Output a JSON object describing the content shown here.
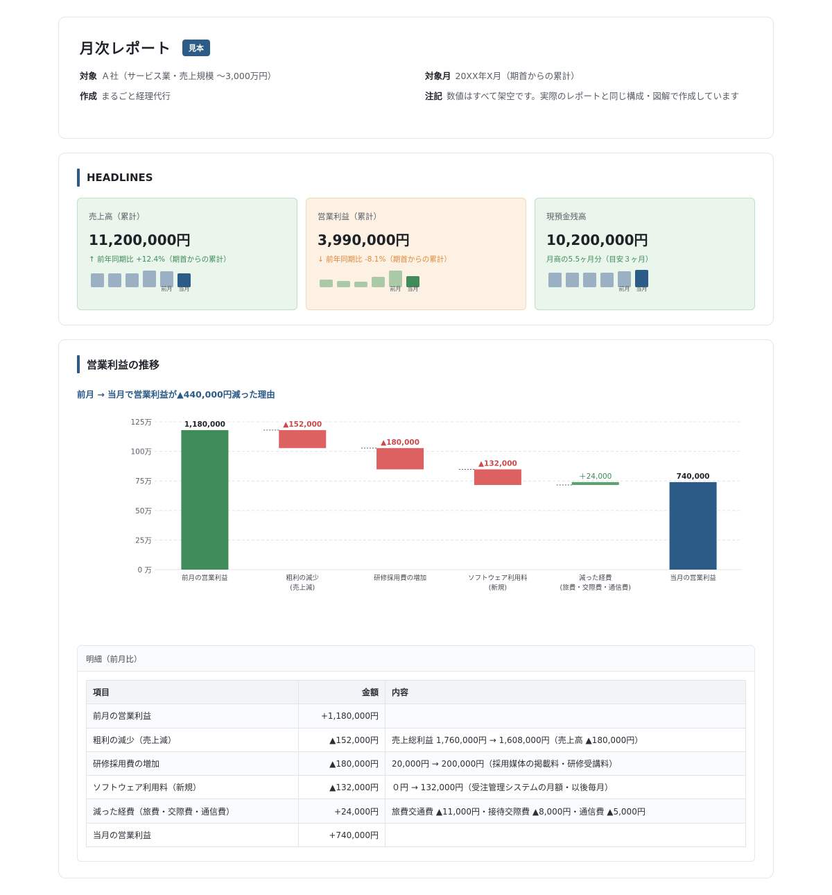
{
  "report": {
    "title": "月次レポート",
    "badge": "見本",
    "meta": [
      {
        "label": "対象",
        "value": "Ａ社（サービス業・売上規模 〜3,000万円）"
      },
      {
        "label": "作成",
        "value": "まるごと経理代行"
      },
      {
        "label": "対象月",
        "value": "20XX年X月（期首からの累計）"
      },
      {
        "label": "注記",
        "value": "数値はすべて架空です。実際のレポートと同じ構成・図解で作成しています"
      }
    ]
  },
  "headlines": {
    "section_title": "HEADLINES",
    "month_labels": {
      "prev": "前月",
      "curr": "当月"
    },
    "kpis": [
      {
        "label": "売上高（累計）",
        "value": "11,200,000円",
        "sub": "↑ 前年同期比 +12.4%（期首からの累計）",
        "bars": [
          0.62,
          0.62,
          0.62,
          0.75,
          0.72,
          0.62
        ],
        "color": "#9bb0c2",
        "highlight": "#2d5b87"
      },
      {
        "label": "営業利益（累計）",
        "value": "3,990,000円",
        "sub": "↓ 前年同期比 -8.1%（期首からの累計）",
        "bars": [
          0.34,
          0.28,
          0.25,
          0.47,
          0.75,
          0.5
        ],
        "color": "#a9c9a7",
        "highlight": "#3f8b5a"
      },
      {
        "label": "現預金残高",
        "value": "10,200,000円",
        "sub": "月商の5.5ヶ月分（目安３ヶ月）",
        "bars": [
          0.65,
          0.65,
          0.65,
          0.65,
          0.72,
          0.78
        ],
        "color": "#9bb0c2",
        "highlight": "#2d5b87"
      }
    ]
  },
  "operating": {
    "section_title": "営業利益の推移",
    "caption": "前月 → 当月で営業利益が▲440,000円減った理由",
    "chart_data": {
      "type": "bar",
      "subtype": "waterfall",
      "unit": "万",
      "ylim": [
        0,
        125
      ],
      "yticks": [
        "0 万",
        "25万",
        "50万",
        "75万",
        "100万",
        "125万"
      ],
      "grid": true,
      "steps": [
        {
          "label": [
            "前月の営業利益"
          ],
          "kind": "total",
          "value": 1180000,
          "display": "1,180,000",
          "color": "#3f8b5a"
        },
        {
          "label": [
            "粗利の減少",
            "(売上減)"
          ],
          "kind": "decrease",
          "value": -152000,
          "display": "▲152,000",
          "color": "#dc6160"
        },
        {
          "label": [
            "研修採用費の増加"
          ],
          "kind": "decrease",
          "value": -180000,
          "display": "▲180,000",
          "color": "#dc6160"
        },
        {
          "label": [
            "ソフトウェア利用料",
            "(新規)"
          ],
          "kind": "decrease",
          "value": -132000,
          "display": "▲132,000",
          "color": "#dc6160"
        },
        {
          "label": [
            "減った経費",
            "(旅費・交際費・通信費)"
          ],
          "kind": "increase",
          "value": 24000,
          "display": "＋24,000",
          "color": "#5aa26f"
        },
        {
          "label": [
            "当月の営業利益"
          ],
          "kind": "total",
          "value": 740000,
          "display": "740,000",
          "color": "#2d5b87"
        }
      ]
    },
    "detail": {
      "title": "明細（前月比）",
      "columns": [
        "項目",
        "金額",
        "内容"
      ],
      "rows": [
        [
          "前月の営業利益",
          "+1,180,000円",
          ""
        ],
        [
          "粗利の減少（売上減）",
          "▲152,000円",
          "売上総利益 1,760,000円 → 1,608,000円（売上高 ▲180,000円）"
        ],
        [
          "研修採用費の増加",
          "▲180,000円",
          "20,000円 → 200,000円（採用媒体の掲載料・研修受講料）"
        ],
        [
          "ソフトウェア利用料（新規）",
          "▲132,000円",
          "０円 → 132,000円（受注管理システムの月額・以後毎月）"
        ],
        [
          "減った経費（旅費・交際費・通信費）",
          "+24,000円",
          "旅費交通費 ▲11,000円・接待交際費 ▲8,000円・通信費 ▲5,000円"
        ],
        [
          "当月の営業利益",
          "+740,000円",
          ""
        ]
      ]
    }
  }
}
